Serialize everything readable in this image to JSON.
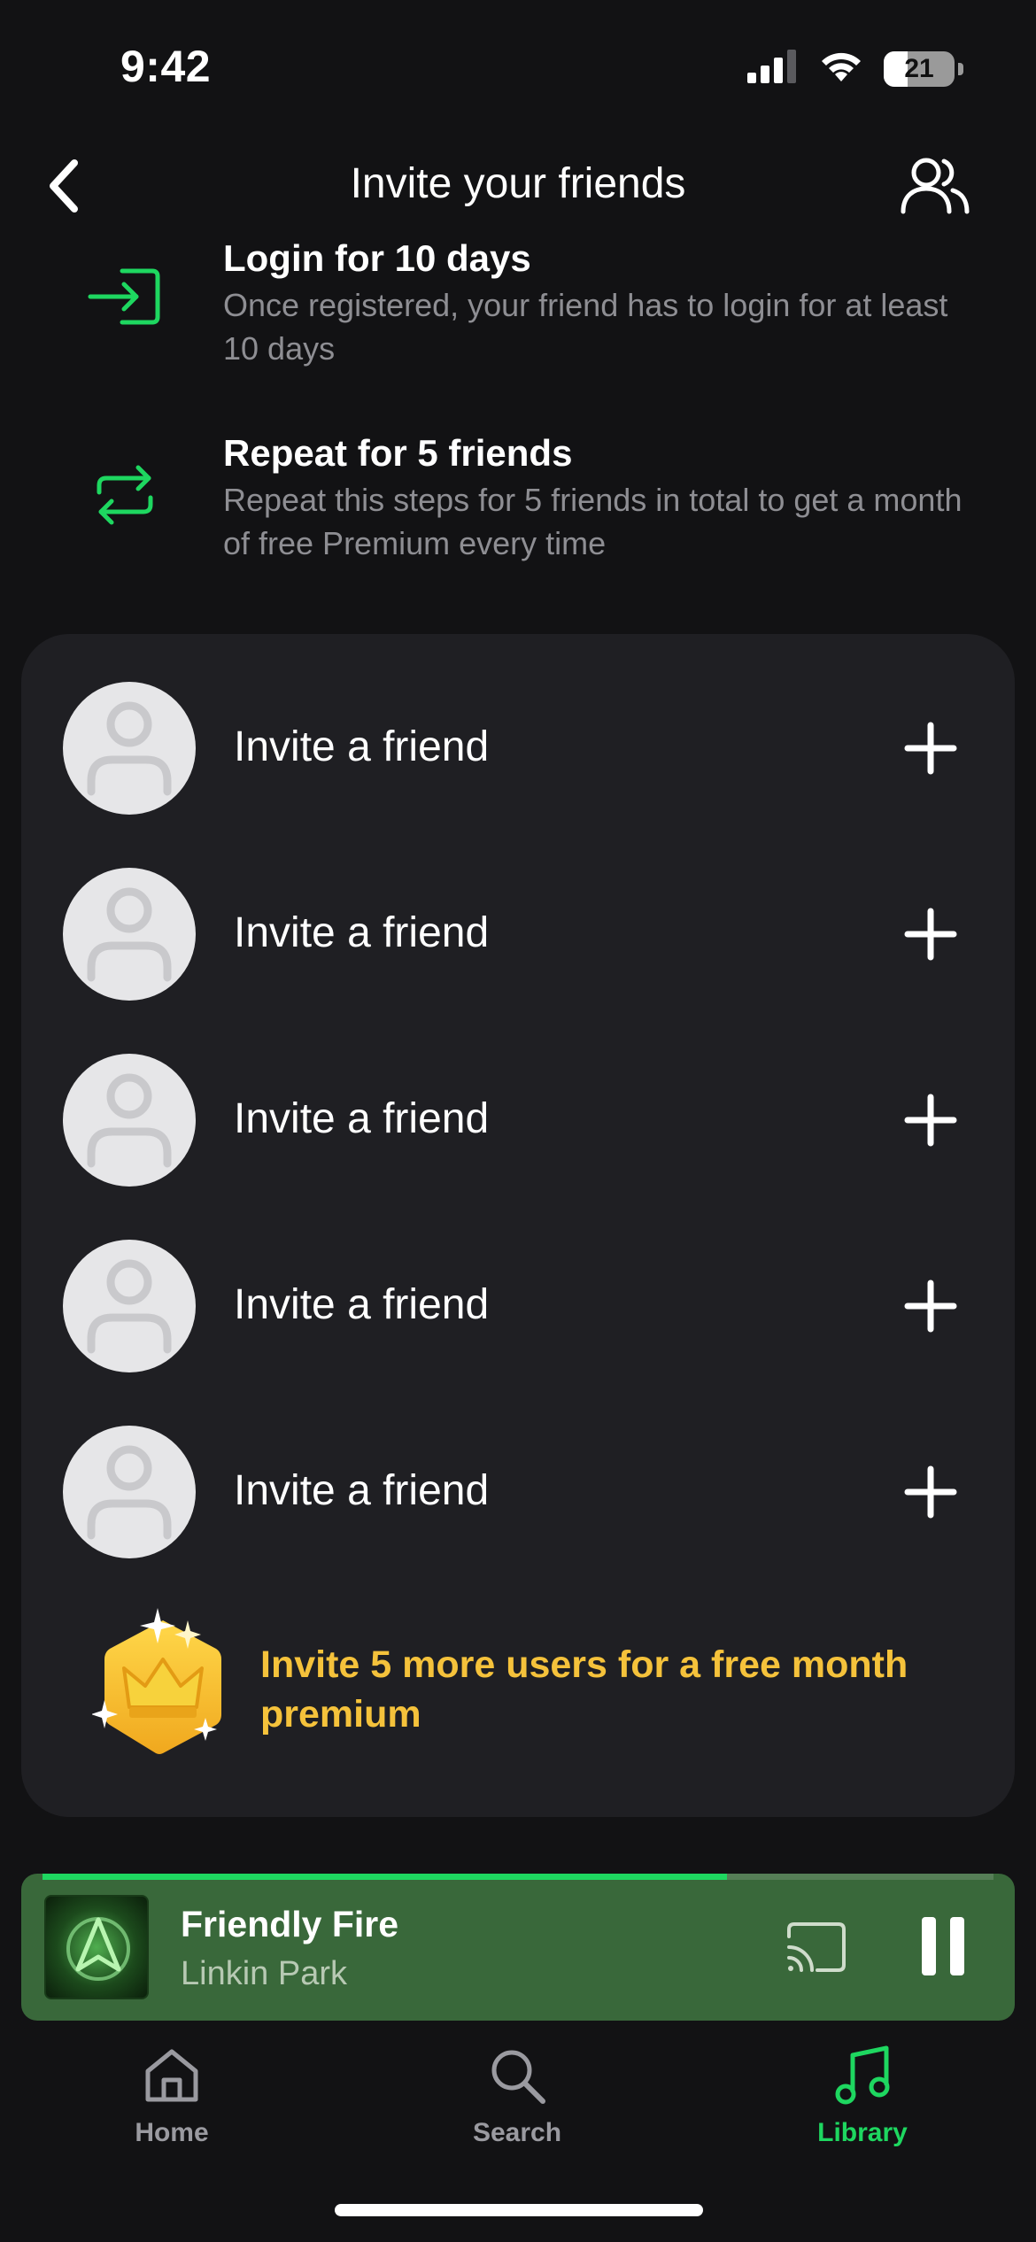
{
  "status_bar": {
    "time": "9:42",
    "battery": "21",
    "signal_icon": "cellular-signal-icon",
    "wifi_icon": "wifi-icon"
  },
  "header": {
    "title": "Invite your friends",
    "back_icon": "chevron-left-icon",
    "friends_icon": "friends-icon"
  },
  "steps": [
    {
      "icon": "login-icon",
      "title": "Login for 10 days",
      "description": "Once registered, your friend has to login for at least 10 days"
    },
    {
      "icon": "repeat-icon",
      "title": "Repeat for 5 friends",
      "description": "Repeat this steps for 5 friends in total to get a month of free Premium every time"
    }
  ],
  "invite_slots": [
    {
      "label": "Invite a friend",
      "avatar_icon": "person-placeholder-icon",
      "action_icon": "plus-icon"
    },
    {
      "label": "Invite a friend",
      "avatar_icon": "person-placeholder-icon",
      "action_icon": "plus-icon"
    },
    {
      "label": "Invite a friend",
      "avatar_icon": "person-placeholder-icon",
      "action_icon": "plus-icon"
    },
    {
      "label": "Invite a friend",
      "avatar_icon": "person-placeholder-icon",
      "action_icon": "plus-icon"
    },
    {
      "label": "Invite a friend",
      "avatar_icon": "person-placeholder-icon",
      "action_icon": "plus-icon"
    }
  ],
  "reward": {
    "icon": "premium-crown-badge-icon",
    "text": "Invite 5 more users for a free month premium"
  },
  "now_playing": {
    "title": "Friendly Fire",
    "artist": "Linkin Park",
    "progress": 0.72,
    "cast_icon": "cast-icon",
    "pause_icon": "pause-icon"
  },
  "tab_bar": {
    "tabs": [
      {
        "label": "Home",
        "icon": "home-icon",
        "active": false
      },
      {
        "label": "Search",
        "icon": "search-icon",
        "active": false
      },
      {
        "label": "Library",
        "icon": "music-note-icon",
        "active": true
      }
    ]
  },
  "colors": {
    "background": "#121214",
    "card": "#1f1f23",
    "accent_green": "#1ed760",
    "reward_gold": "#f5c23b",
    "player_bg": "#39683a",
    "muted_text": "#8e8e93",
    "tab_inactive": "#9a9aa0"
  }
}
